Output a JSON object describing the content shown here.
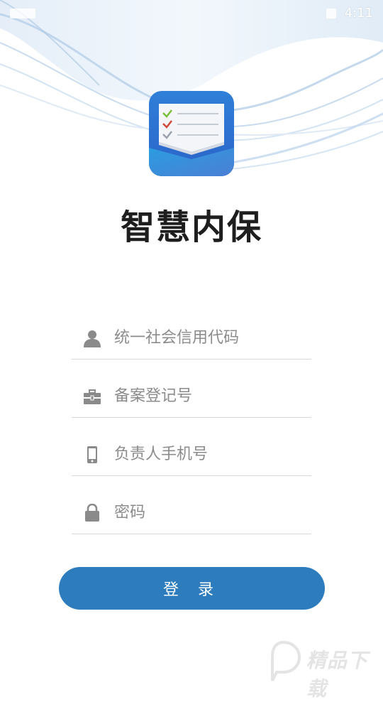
{
  "status_bar": {
    "time": "4:11"
  },
  "app": {
    "title": "智慧内保"
  },
  "form": {
    "fields": [
      {
        "placeholder": "统一社会信用代码",
        "icon": "user-icon"
      },
      {
        "placeholder": "备案登记号",
        "icon": "briefcase-icon"
      },
      {
        "placeholder": "负责人手机号",
        "icon": "phone-icon"
      },
      {
        "placeholder": "密码",
        "icon": "lock-icon"
      }
    ],
    "login_label": "登 录"
  },
  "watermark": {
    "text": "精品下载"
  },
  "colors": {
    "primary": "#2d7cbd",
    "title": "#1e1e1e",
    "placeholder": "#8c8c8c",
    "icon": "#8a8a8a",
    "divider": "#d8d8d8"
  }
}
